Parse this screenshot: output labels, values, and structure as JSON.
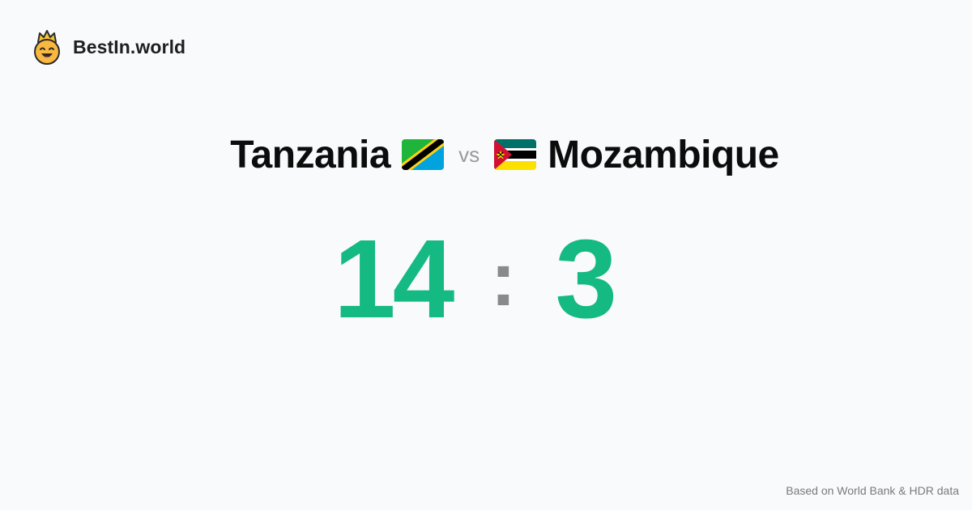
{
  "brand": {
    "name": "BestIn.world",
    "logo_icon": "smiling-crown-face-icon"
  },
  "comparison": {
    "left_country": "Tanzania",
    "left_flag_icon": "tanzania-flag-icon",
    "vs_label": "vs",
    "right_country": "Mozambique",
    "right_flag_icon": "mozambique-flag-icon"
  },
  "score": {
    "left": "14",
    "separator": ":",
    "right": "3",
    "color": "#15b982"
  },
  "footer": {
    "source_text": "Based on World Bank & HDR data"
  }
}
